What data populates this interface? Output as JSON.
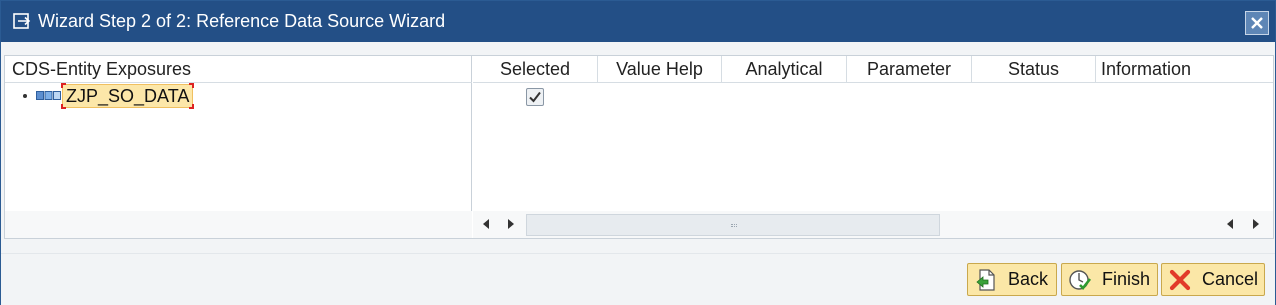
{
  "window": {
    "title": "Wizard Step 2 of 2: Reference Data Source Wizard",
    "icon": "wizard-window-icon",
    "close_icon": "close-icon"
  },
  "tree": {
    "header": "CDS-Entity Exposures",
    "items": [
      {
        "label": "ZJP_SO_DATA",
        "icon": "cds-entity-icon",
        "selected": true
      }
    ]
  },
  "grid": {
    "columns": [
      "Selected",
      "Value Help",
      "Analytical",
      "Parameter",
      "Status",
      "Information"
    ],
    "rows": [
      {
        "selected": true,
        "value_help": "",
        "analytical": "",
        "parameter": "",
        "status": "",
        "information": ""
      }
    ]
  },
  "buttons": {
    "back": {
      "label": "Back",
      "icon": "back-icon"
    },
    "finish": {
      "label": "Finish",
      "icon": "finish-icon"
    },
    "cancel": {
      "label": "Cancel",
      "icon": "cancel-icon"
    }
  },
  "colors": {
    "titlebar": "#234f86",
    "button_bg": "#fbe7a7",
    "node_highlight": "#fce7a9",
    "cancel_red": "#e23b2a"
  }
}
